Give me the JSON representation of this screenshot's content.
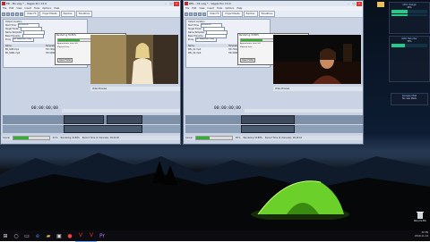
{
  "left_window": {
    "title": "ER - Bo.veg * - Vegas Pro 13.0",
    "menu": [
      "File",
      "Edit",
      "View",
      "Insert",
      "Tools",
      "Options",
      "Help"
    ],
    "tabs": [
      "Video FX",
      "Project Media",
      "Explorer",
      "Transitions"
    ],
    "props": [
      {
        "label": "Output Location",
        "value": ""
      },
      {
        "label": "Start Time",
        "value": "00:00:00;00"
      },
      {
        "label": "Target Folder",
        "value": ""
      },
      {
        "label": "Name Template",
        "value": ""
      },
      {
        "label": "Base Filename",
        "value": ""
      },
      {
        "label": "Proxy",
        "value": "HD Widescreen Proxy"
      }
    ],
    "dialog": {
      "title": "Rendering 32.89%",
      "percent": 32.89,
      "rows": [
        {
          "label": "Approximate time left",
          "value": "00:07:35"
        },
        {
          "label": "Elapsed time",
          "value": "00:03:24"
        }
      ],
      "open_folder": "Open Folder",
      "cancel": "Cancel"
    },
    "table_head": [
      "Name",
      "Template"
    ],
    "table_rows": [
      [
        "ER_SOB.mp4",
        "HD 720p 25p 4K"
      ],
      [
        "ER_SOB1.mp4",
        "HD 1080p 25 fps"
      ]
    ],
    "timecode": "00:00:00;00",
    "preview_label": "Video Preview",
    "status": {
      "label": "Cancel",
      "percent_text": "44 %",
      "percent": 44,
      "task": "Rendering 32.89%",
      "time": "Record Time (2 channels): 16:24:46"
    }
  },
  "right_window": {
    "title": "REL - 01.veg * - Vegas Pro 13.0",
    "menu": [
      "File",
      "Edit",
      "View",
      "Insert",
      "Tools",
      "Options",
      "Help"
    ],
    "tabs": [
      "Video FX",
      "Project Media",
      "Explorer",
      "Transitions"
    ],
    "props": [
      {
        "label": "Output Location",
        "value": ""
      },
      {
        "label": "Start Time",
        "value": "00:00:00;00"
      },
      {
        "label": "Target Folder",
        "value": ""
      },
      {
        "label": "Name Template",
        "value": ""
      },
      {
        "label": "Base Filename",
        "value": ""
      },
      {
        "label": "Proxy",
        "value": "HD Widescreen Proxy"
      }
    ],
    "dialog": {
      "title": "Rendering 33.88%",
      "percent": 33.88,
      "rows": [
        {
          "label": "Approximate time left",
          "value": "00:06:12"
        },
        {
          "label": "Elapsed time",
          "value": "00:03:08"
        }
      ],
      "open_folder": "Open Folder",
      "cancel": "Cancel"
    },
    "table_head": [
      "Name",
      "Template"
    ],
    "table_rows": [
      [
        "REL_01.mp4",
        "HD 720p 25p 4K"
      ],
      [
        "REL_02.mp4",
        "HD 1080p 25 fps"
      ]
    ],
    "timecode": "00:00:00;00",
    "preview_label": "Video Preview",
    "status": {
      "label": "Cancel",
      "percent_text": "38 %",
      "percent": 38,
      "task": "Rendering 33.88%",
      "time": "Record Time (2 channels): 16:24:44"
    }
  },
  "desktop_icons": [
    {
      "label": "Recycle Bin",
      "icon": "recycle-bin-icon"
    }
  ],
  "widgets": {
    "cpu": {
      "title": "CPU Usage",
      "value": "46%",
      "percent": 46
    },
    "gpu": {
      "title": "GPU Monitor",
      "value": "38%",
      "percent": 38
    },
    "net": {
      "title": "Google Mail",
      "value": "No new Mails"
    }
  },
  "taskbar": {
    "apps": [
      "start-icon",
      "search-icon",
      "task-view-icon",
      "edge-icon",
      "explorer-icon",
      "store-icon",
      "chrome-icon",
      "vegas-icon",
      "vegas-icon",
      "premiere-icon"
    ],
    "time": "22:39",
    "date": "2019-11-14"
  }
}
